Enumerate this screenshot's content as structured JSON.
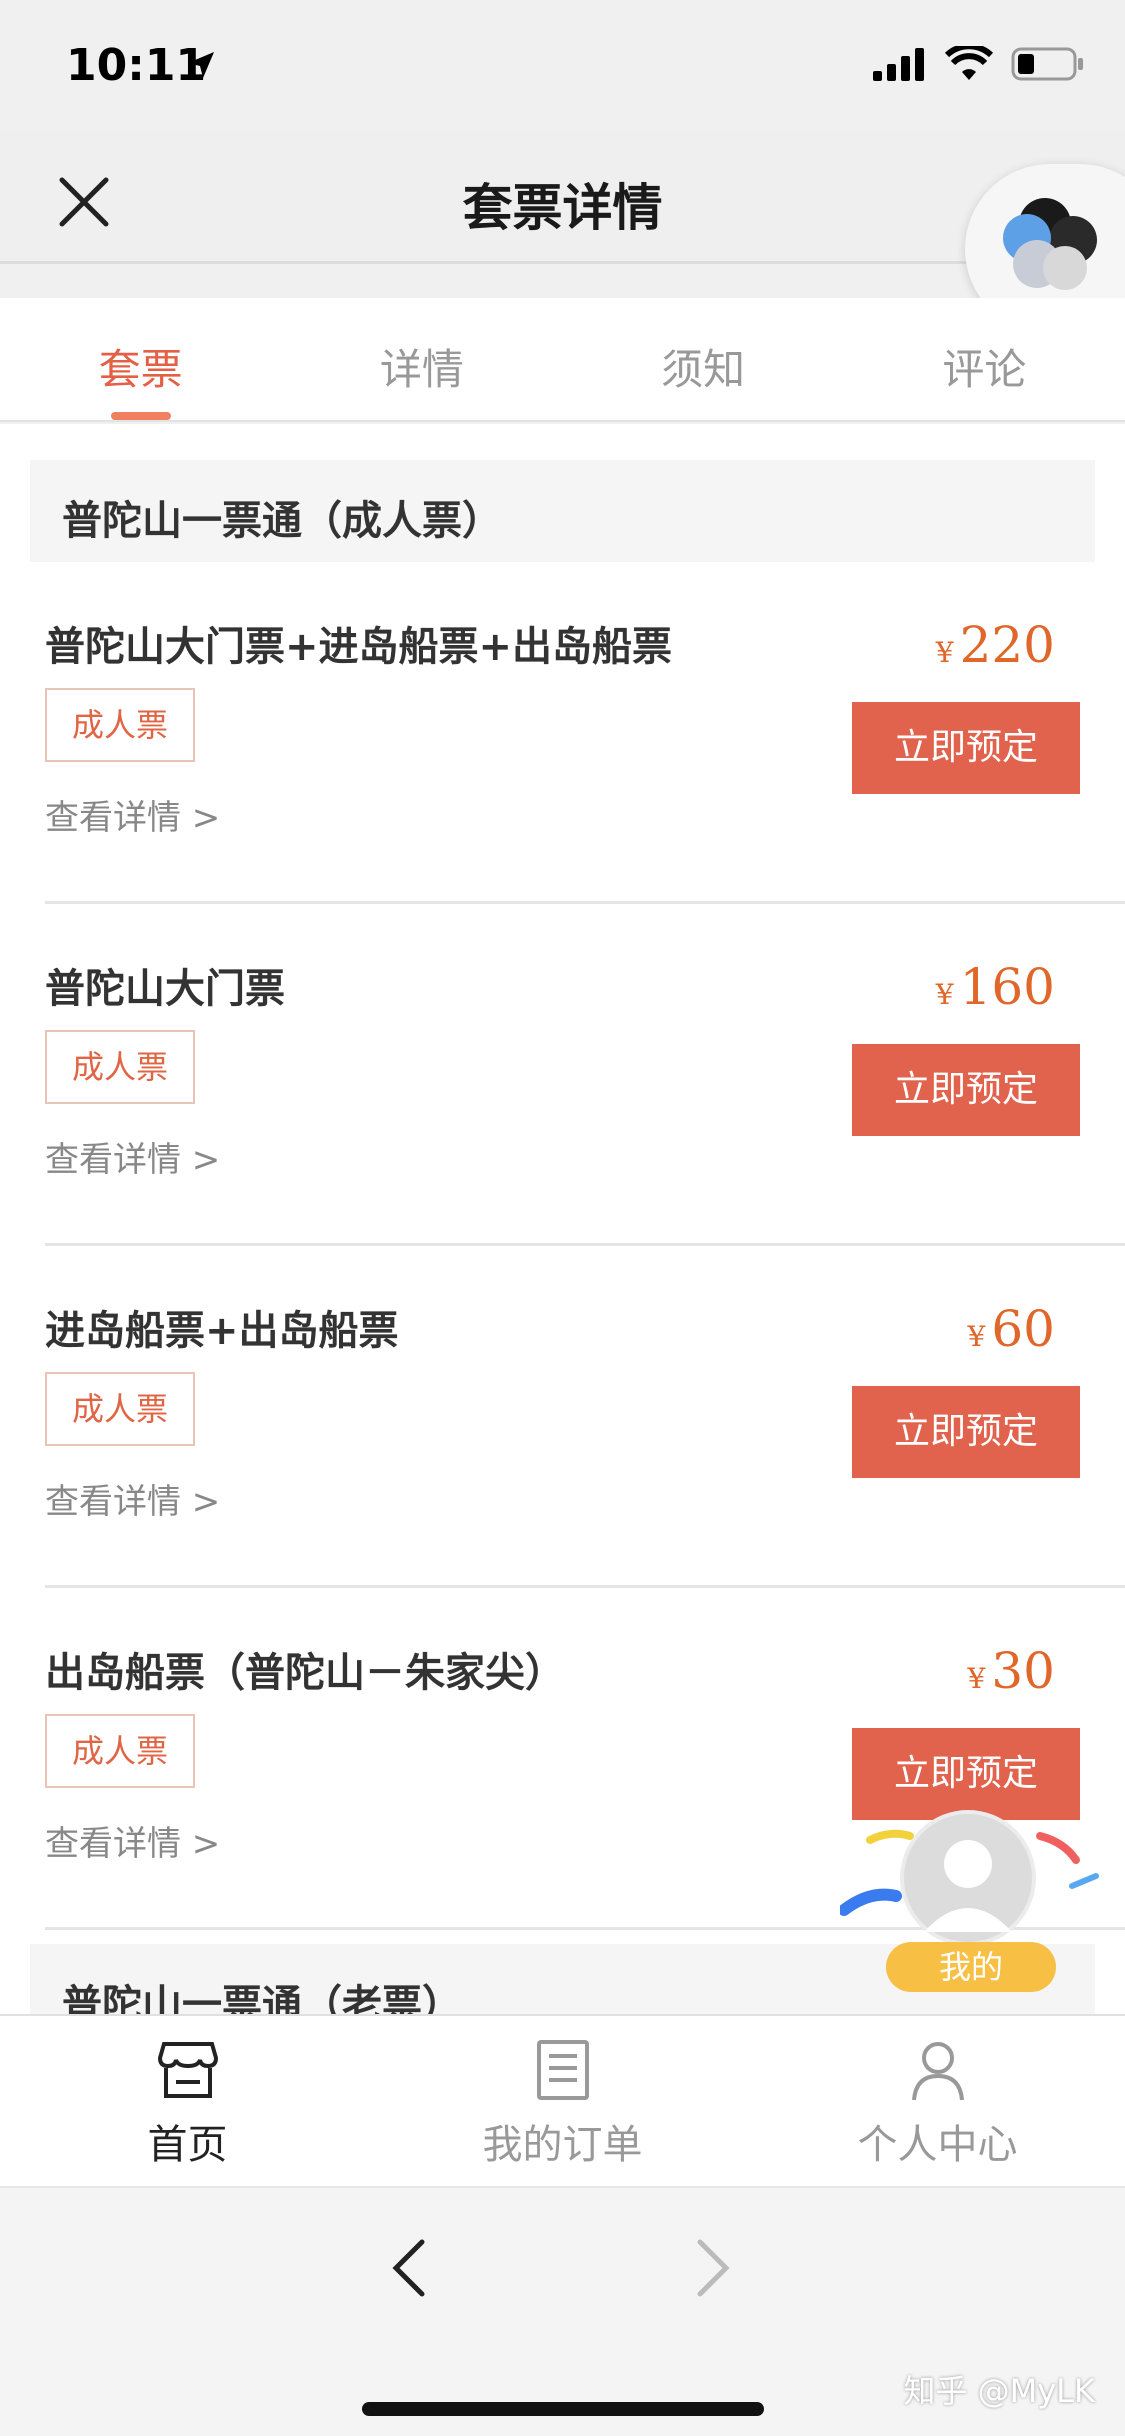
{
  "status_bar": {
    "time": "10:11"
  },
  "nav": {
    "title": "套票详情"
  },
  "tabs": [
    {
      "label": "套票",
      "active": true
    },
    {
      "label": "详情",
      "active": false
    },
    {
      "label": "须知",
      "active": false
    },
    {
      "label": "评论",
      "active": false
    }
  ],
  "sections": [
    {
      "title": "普陀山一票通（成人票）",
      "tickets": [
        {
          "name": "普陀山大门票+进岛船票+出岛船票",
          "tag": "成人票",
          "detail": "查看详情 >",
          "currency": "¥",
          "price": "220",
          "button": "立即预定"
        },
        {
          "name": "普陀山大门票",
          "tag": "成人票",
          "detail": "查看详情 >",
          "currency": "¥",
          "price": "160",
          "button": "立即预定"
        },
        {
          "name": "进岛船票+出岛船票",
          "tag": "成人票",
          "detail": "查看详情 >",
          "currency": "¥",
          "price": "60",
          "button": "立即预定"
        },
        {
          "name": "出岛船票（普陀山－朱家尖）",
          "tag": "成人票",
          "detail": "查看详情 >",
          "currency": "¥",
          "price": "30",
          "button": "立即预定"
        }
      ]
    }
  ],
  "next_section_title": "普陀山一票通（老票）",
  "floating_mine": {
    "label": "我的"
  },
  "bottom_nav": [
    {
      "label": "首页",
      "icon": "store-icon",
      "active": true
    },
    {
      "label": "我的订单",
      "icon": "order-list-icon",
      "active": false
    },
    {
      "label": "个人中心",
      "icon": "user-icon",
      "active": false
    }
  ],
  "watermark": "知乎 @MyLK",
  "colors": {
    "accent": "#e1634d",
    "price": "#e0662a",
    "tab_active": "#e35f45"
  }
}
